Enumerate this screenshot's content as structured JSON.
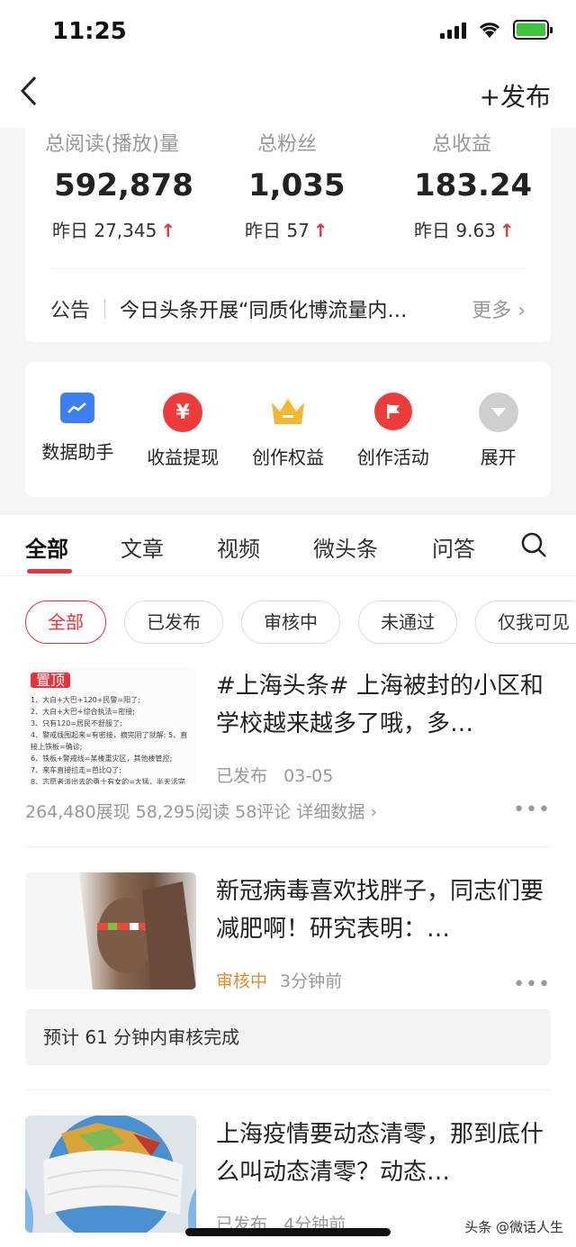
{
  "status_bar": {
    "time": "11:25"
  },
  "nav": {
    "publish_label": "+发布"
  },
  "stats": [
    {
      "label": "总阅读(播放)量",
      "value": "592,878",
      "sub": "昨日 27,345"
    },
    {
      "label": "总粉丝",
      "value": "1,035",
      "sub": "昨日 57"
    },
    {
      "label": "总收益",
      "value": "183.24",
      "sub": "昨日 9.63"
    }
  ],
  "notice": {
    "label": "公告",
    "text": "今日头条开展“同质化博流量内…",
    "more": "更多"
  },
  "tools": [
    {
      "label": "数据助手",
      "icon": "chart-icon",
      "color": "#3b7ff0"
    },
    {
      "label": "收益提现",
      "icon": "yuan-icon",
      "color": "#ee3b3b"
    },
    {
      "label": "创作权益",
      "icon": "crown-icon",
      "color": "#f5b731"
    },
    {
      "label": "创作活动",
      "icon": "flag-icon",
      "color": "#ee3b3b"
    },
    {
      "label": "展开",
      "icon": "expand-icon",
      "color": "#cfcfcf"
    }
  ],
  "tabs": [
    "全部",
    "文章",
    "视频",
    "微头条",
    "问答"
  ],
  "filters": [
    "全部",
    "已发布",
    "审核中",
    "未通过",
    "仅我可见"
  ],
  "articles": [
    {
      "pin": "置顶",
      "title": "#上海头条# 上海被封的小区和学校越来越多了哦，多…",
      "status": "已发布",
      "time": "03-05",
      "stats": "264,480展现   58,295阅读   58评论   详细数据 ›",
      "thumb_lines": [
        "1、大白+大巴+120+民警=阳了;",
        "2、大白+大巴+综合执法=密接;",
        "3、只有120=居民不舒服了;",
        "4、警戒线围起来=有密接，摘完阴了就解; 5、直接上铁板=确诊;",
        "6、铁板+警戒线=某楼重灾区，其他楼管控;",
        "7、来车直接拉走=芭比Q了;",
        "8、志愿者派出去的勇士有女的=大猛，半天活完事;"
      ]
    },
    {
      "title": "新冠病毒喜欢找胖子，同志们要减肥啊！研究表明：…",
      "status": "审核中",
      "time": "3分钟前",
      "review_note": "预计 61 分钟内审核完成"
    },
    {
      "title": "上海疫情要动态清零，那到底什么叫动态清零？动态…",
      "status": "已发布",
      "time": "4分钟前"
    }
  ],
  "watermark": "头条 @微话人生",
  "colors": {
    "accent": "#e8333b",
    "reviewing": "#d98d3a"
  }
}
